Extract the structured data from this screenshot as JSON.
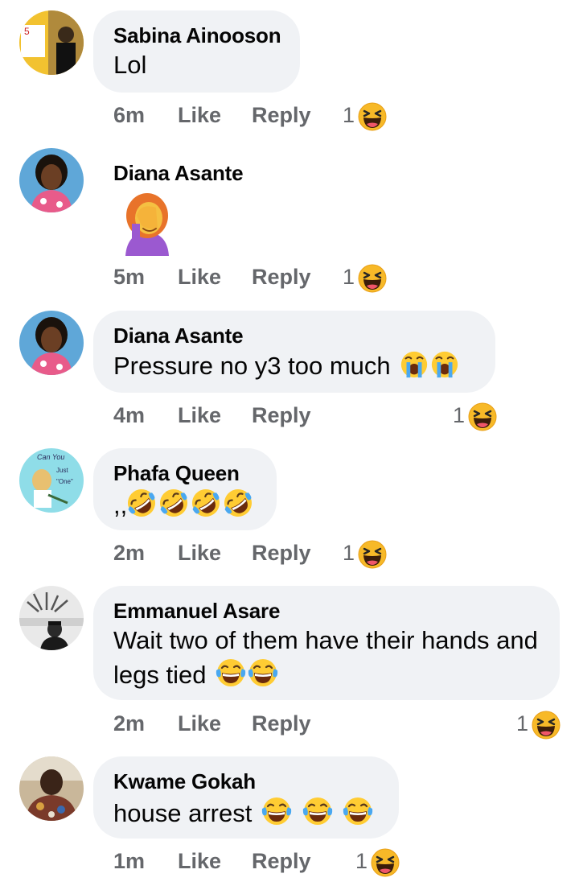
{
  "comments": [
    {
      "author": "Sabina Ainooson",
      "text": "Lol",
      "time": "6m",
      "like": "Like",
      "reply": "Reply",
      "reactions": "1"
    },
    {
      "author": "Diana Asante",
      "text": "",
      "time": "5m",
      "like": "Like",
      "reply": "Reply",
      "reactions": "1"
    },
    {
      "author": "Diana Asante",
      "text": "Pressure no y3 too much",
      "time": "4m",
      "like": "Like",
      "reply": "Reply",
      "reactions": "1"
    },
    {
      "author": "Phafa Queen",
      "text": ",,",
      "time": "2m",
      "like": "Like",
      "reply": "Reply",
      "reactions": "1"
    },
    {
      "author": "Emmanuel Asare",
      "text": "Wait two of them have their hands and legs tied",
      "time": "2m",
      "like": "Like",
      "reply": "Reply",
      "reactions": "1"
    },
    {
      "author": "Kwame Gokah",
      "text": "house arrest",
      "time": "1m",
      "like": "Like",
      "reply": "Reply",
      "reactions": "1"
    }
  ],
  "icons": {
    "reaction": "haha-reaction-icon",
    "laugh": "tears-of-joy-emoji",
    "cry": "loudly-crying-face-emoji",
    "rofl": "rolling-on-floor-laughing-emoji",
    "facepalm": "woman-facepalming-emoji"
  },
  "colors": {
    "bubble": "#f0f2f5",
    "meta": "#65676b",
    "text": "#050505",
    "emoji_yellow": "#ffcc33"
  }
}
